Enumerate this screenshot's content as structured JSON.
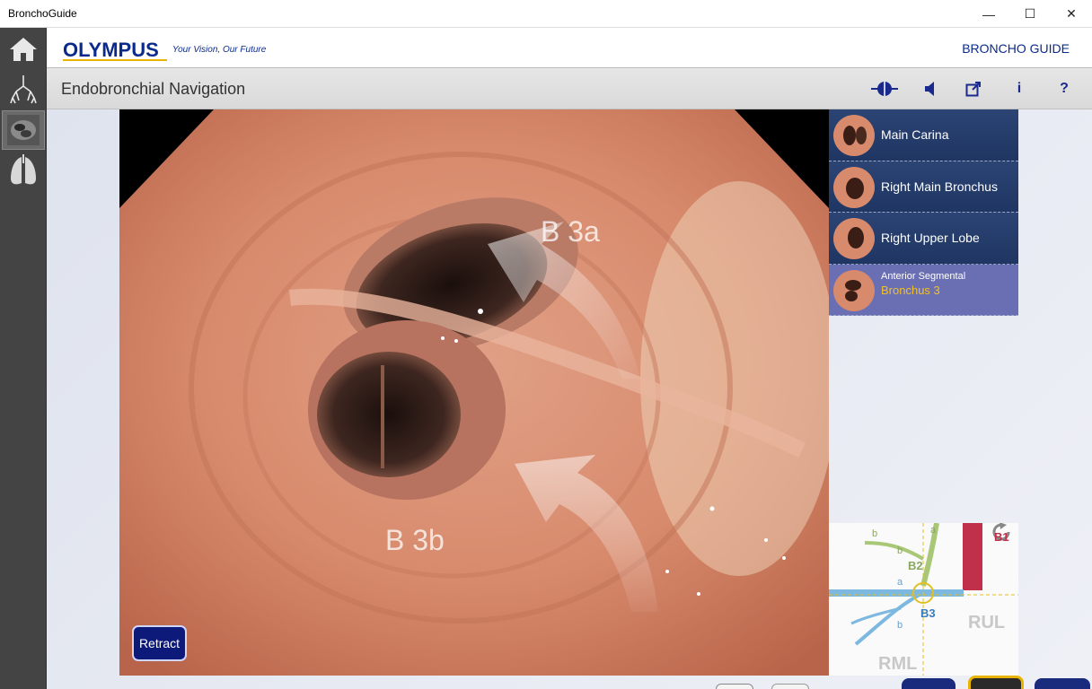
{
  "window": {
    "title": "BronchoGuide",
    "minimize_glyph": "—",
    "maximize_glyph": "☐",
    "close_glyph": "✕"
  },
  "brand": {
    "logo": "OLYMPUS",
    "tagline": "Your Vision, Our Future",
    "app_name": "BRONCHO GUIDE"
  },
  "toolbar": {
    "title": "Endobronchial Navigation",
    "icons": [
      "bronchoscope-icon",
      "speaker-icon",
      "external-link-icon",
      "info-icon",
      "help-icon"
    ],
    "info_glyph": "i",
    "help_glyph": "?"
  },
  "sidebar": {
    "items": [
      {
        "name": "home",
        "icon": "home-icon",
        "active": false
      },
      {
        "name": "bronchial-tree",
        "icon": "bronchial-tree-icon",
        "active": false
      },
      {
        "name": "endobronchial",
        "icon": "endoscope-view-icon",
        "active": true
      },
      {
        "name": "lungs",
        "icon": "lungs-icon",
        "active": false
      }
    ]
  },
  "endoscope": {
    "labels": [
      "B 3a",
      "B 3b"
    ],
    "retract_label": "Retract"
  },
  "breadcrumbs": [
    {
      "label": "Main Carina"
    },
    {
      "label": "Right Main Bronchus"
    },
    {
      "label": "Right Upper Lobe"
    },
    {
      "label_small": "Anterior Segmental",
      "label_highlight": "Bronchus 3"
    }
  ],
  "mini_map": {
    "labels": {
      "a1": "a",
      "b1": "b",
      "b1_seg": "B1",
      "b2": "B2",
      "a2": "a",
      "b3": "B3",
      "b2_small": "b",
      "rul": "RUL",
      "rml": "RML"
    }
  },
  "colors": {
    "brand_blue": "#0a2b8c",
    "crumb_bg": "#2c4474",
    "crumb_active_bg": "#6a6fb3",
    "highlight": "#f0c030"
  }
}
